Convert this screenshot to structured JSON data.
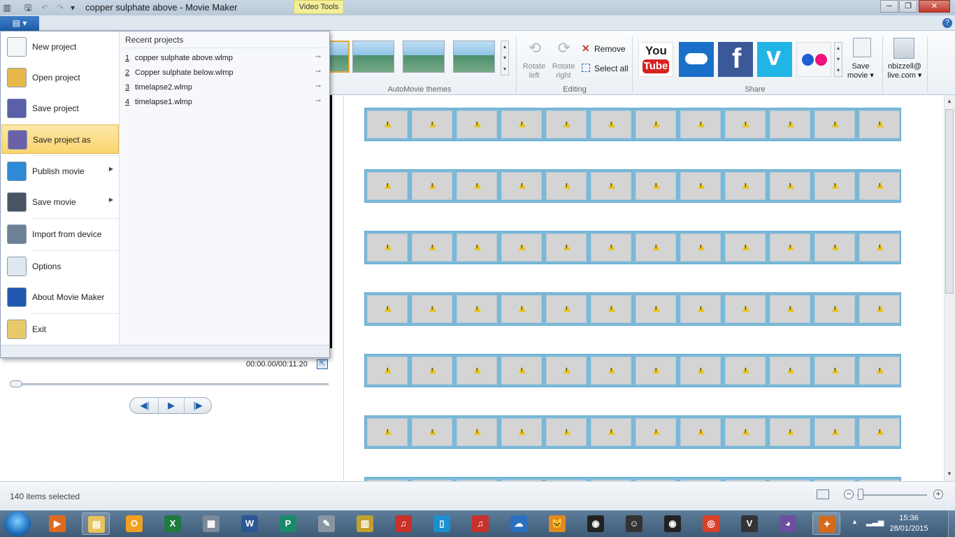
{
  "window": {
    "title": "copper sulphate above - Movie Maker",
    "contextual_tab": "Video Tools",
    "min_label": "─",
    "max_label": "❐",
    "close_label": "✕"
  },
  "ribbon": {
    "file_tab_label": "▤ ▾",
    "help_label": "?",
    "groups": {
      "automovie_label": "AutoMovie themes",
      "editing_label": "Editing",
      "share_label": "Share"
    },
    "editing": {
      "rotate_left": "Rotate left",
      "rotate_right": "Rotate right",
      "remove": "Remove",
      "select_all": "Select all"
    },
    "share": {
      "youtube_you": "You",
      "youtube_tube": "Tube",
      "facebook": "f",
      "vimeo": "v",
      "save_movie": "Save movie ▾",
      "account": "nbizzell@ live.com ▾"
    }
  },
  "file_menu": {
    "items": [
      {
        "label": "New project",
        "icon": "new-document-icon"
      },
      {
        "label": "Open project",
        "icon": "open-folder-icon"
      },
      {
        "label": "Save project",
        "icon": "floppy-disk-icon"
      },
      {
        "label": "Save project as",
        "icon": "save-as-icon",
        "highlighted": true
      },
      {
        "label": "Publish movie",
        "icon": "globe-icon",
        "submenu": true
      },
      {
        "label": "Save movie",
        "icon": "film-icon",
        "submenu": true
      },
      {
        "label": "Import from device",
        "icon": "camera-icon"
      },
      {
        "label": "Options",
        "icon": "checklist-icon"
      },
      {
        "label": "About Movie Maker",
        "icon": "info-icon"
      },
      {
        "label": "Exit",
        "icon": "exit-icon"
      }
    ],
    "submenu_arrow": "▶",
    "recent_heading": "Recent projects",
    "recent": [
      {
        "num": "1",
        "name": "copper sulphate above.wlmp"
      },
      {
        "num": "2",
        "name": "Copper sulphate below.wlmp"
      },
      {
        "num": "3",
        "name": "timelapse2.wlmp"
      },
      {
        "num": "4",
        "name": "timelapse1.wlmp"
      }
    ],
    "pin_glyph": "⊸"
  },
  "preview": {
    "timecode": "00:00.00/00:11.20",
    "fullscreen_glyph": "⇱",
    "prev_glyph": "◀|",
    "play_glyph": "▶",
    "next_glyph": "|▶",
    "seek_position": 0.0
  },
  "storyboard": {
    "rows_visible": 6,
    "clips_per_row": 12,
    "clip_state": "missing-media-warning"
  },
  "status": {
    "text": "140 items selected",
    "zoom_out": "−",
    "zoom_in": "+"
  },
  "taskbar": {
    "time": "15:36",
    "date": "28/01/2015",
    "apps": [
      {
        "name": "media-player",
        "color": "#e06a1b",
        "glyph": "▶"
      },
      {
        "name": "file-explorer",
        "color": "#e7c35a",
        "glyph": "▤"
      },
      {
        "name": "outlook",
        "color": "#f0a020",
        "glyph": "O"
      },
      {
        "name": "excel",
        "color": "#1f7a3d",
        "glyph": "X"
      },
      {
        "name": "calculator",
        "color": "#7c8a99",
        "glyph": "▦"
      },
      {
        "name": "word",
        "color": "#2b5797",
        "glyph": "W"
      },
      {
        "name": "publisher",
        "color": "#1a8a6a",
        "glyph": "P"
      },
      {
        "name": "tools",
        "color": "#8a95a3",
        "glyph": "✎"
      },
      {
        "name": "monitor",
        "color": "#c0a030",
        "glyph": "▥"
      },
      {
        "name": "piano-app",
        "color": "#c8302a",
        "glyph": "♫"
      },
      {
        "name": "device-app",
        "color": "#1c8fd0",
        "glyph": "▯"
      },
      {
        "name": "piano-app-2",
        "color": "#c8302a",
        "glyph": "♫"
      },
      {
        "name": "onedrive",
        "color": "#2a6fc0",
        "glyph": "☁"
      },
      {
        "name": "scratch",
        "color": "#e08a20",
        "glyph": "🐱"
      },
      {
        "name": "recorder",
        "color": "#222222",
        "glyph": "◉"
      },
      {
        "name": "smiley",
        "color": "#333333",
        "glyph": "☺"
      },
      {
        "name": "recorder-2",
        "color": "#222222",
        "glyph": "◉"
      },
      {
        "name": "chrome",
        "color": "#d8402a",
        "glyph": "◎"
      },
      {
        "name": "vnc",
        "color": "#333333",
        "glyph": "V"
      },
      {
        "name": "cat-app",
        "color": "#6b4fa0",
        "glyph": "◕"
      },
      {
        "name": "movie-maker",
        "color": "#d46a1a",
        "glyph": "✦"
      }
    ]
  },
  "colors": {
    "file_tab": "#1e5ca6",
    "highlight": "#fbd46e",
    "clip_border": "#7ab8d8",
    "warning": "#e8c21a"
  }
}
